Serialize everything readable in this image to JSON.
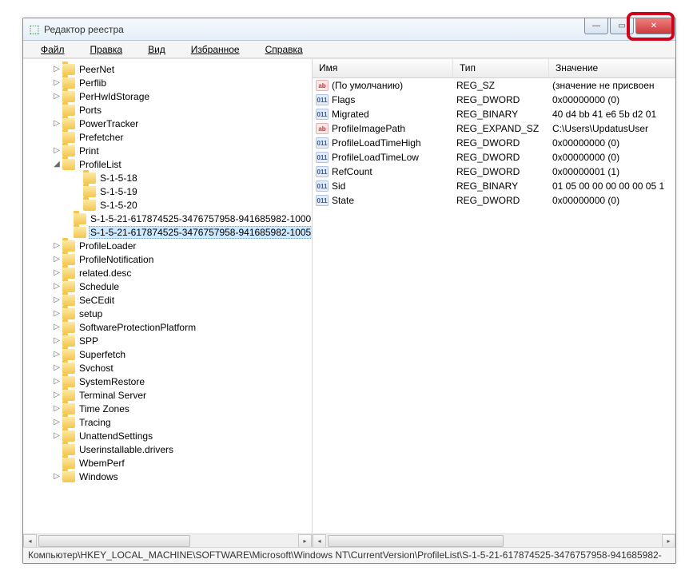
{
  "window": {
    "title": "Редактор реестра"
  },
  "menu": {
    "file": "Файл",
    "edit": "Правка",
    "view": "Вид",
    "favorites": "Избранное",
    "help": "Справка"
  },
  "tree": {
    "items": [
      {
        "label": "PeerNet",
        "depth": 0,
        "twisty": "▷"
      },
      {
        "label": "Perflib",
        "depth": 0,
        "twisty": "▷"
      },
      {
        "label": "PerHwIdStorage",
        "depth": 0,
        "twisty": "▷"
      },
      {
        "label": "Ports",
        "depth": 0,
        "twisty": ""
      },
      {
        "label": "PowerTracker",
        "depth": 0,
        "twisty": "▷"
      },
      {
        "label": "Prefetcher",
        "depth": 0,
        "twisty": ""
      },
      {
        "label": "Print",
        "depth": 0,
        "twisty": "▷"
      },
      {
        "label": "ProfileList",
        "depth": 0,
        "twisty": "◢",
        "expanded": true
      },
      {
        "label": "S-1-5-18",
        "depth": 1,
        "twisty": ""
      },
      {
        "label": "S-1-5-19",
        "depth": 1,
        "twisty": ""
      },
      {
        "label": "S-1-5-20",
        "depth": 1,
        "twisty": ""
      },
      {
        "label": "S-1-5-21-617874525-3476757958-941685982-1000",
        "depth": 1,
        "twisty": ""
      },
      {
        "label": "S-1-5-21-617874525-3476757958-941685982-1005",
        "depth": 1,
        "twisty": "",
        "selected": true
      },
      {
        "label": "ProfileLoader",
        "depth": 0,
        "twisty": "▷"
      },
      {
        "label": "ProfileNotification",
        "depth": 0,
        "twisty": "▷"
      },
      {
        "label": "related.desc",
        "depth": 0,
        "twisty": "▷"
      },
      {
        "label": "Schedule",
        "depth": 0,
        "twisty": "▷"
      },
      {
        "label": "SeCEdit",
        "depth": 0,
        "twisty": "▷"
      },
      {
        "label": "setup",
        "depth": 0,
        "twisty": "▷"
      },
      {
        "label": "SoftwareProtectionPlatform",
        "depth": 0,
        "twisty": "▷"
      },
      {
        "label": "SPP",
        "depth": 0,
        "twisty": "▷"
      },
      {
        "label": "Superfetch",
        "depth": 0,
        "twisty": "▷"
      },
      {
        "label": "Svchost",
        "depth": 0,
        "twisty": "▷"
      },
      {
        "label": "SystemRestore",
        "depth": 0,
        "twisty": "▷"
      },
      {
        "label": "Terminal Server",
        "depth": 0,
        "twisty": "▷"
      },
      {
        "label": "Time Zones",
        "depth": 0,
        "twisty": "▷"
      },
      {
        "label": "Tracing",
        "depth": 0,
        "twisty": "▷"
      },
      {
        "label": "UnattendSettings",
        "depth": 0,
        "twisty": "▷"
      },
      {
        "label": "Userinstallable.drivers",
        "depth": 0,
        "twisty": ""
      },
      {
        "label": "WbemPerf",
        "depth": 0,
        "twisty": ""
      },
      {
        "label": "Windows",
        "depth": 0,
        "twisty": "▷"
      }
    ]
  },
  "list": {
    "headers": {
      "name": "Имя",
      "type": "Тип",
      "data": "Значение"
    },
    "rows": [
      {
        "icon": "sz",
        "name": "(По умолчанию)",
        "type": "REG_SZ",
        "data": "(значение не присвоен"
      },
      {
        "icon": "bin",
        "name": "Flags",
        "type": "REG_DWORD",
        "data": "0x00000000 (0)"
      },
      {
        "icon": "bin",
        "name": "Migrated",
        "type": "REG_BINARY",
        "data": "40 d4 bb 41 e6 5b d2 01"
      },
      {
        "icon": "sz",
        "name": "ProfileImagePath",
        "type": "REG_EXPAND_SZ",
        "data": "C:\\Users\\UpdatusUser"
      },
      {
        "icon": "bin",
        "name": "ProfileLoadTimeHigh",
        "type": "REG_DWORD",
        "data": "0x00000000 (0)"
      },
      {
        "icon": "bin",
        "name": "ProfileLoadTimeLow",
        "type": "REG_DWORD",
        "data": "0x00000000 (0)"
      },
      {
        "icon": "bin",
        "name": "RefCount",
        "type": "REG_DWORD",
        "data": "0x00000001 (1)"
      },
      {
        "icon": "bin",
        "name": "Sid",
        "type": "REG_BINARY",
        "data": "01 05 00 00 00 00 00 05 1"
      },
      {
        "icon": "bin",
        "name": "State",
        "type": "REG_DWORD",
        "data": "0x00000000 (0)"
      }
    ]
  },
  "statusbar": {
    "path": "Компьютер\\HKEY_LOCAL_MACHINE\\SOFTWARE\\Microsoft\\Windows NT\\CurrentVersion\\ProfileList\\S-1-5-21-617874525-3476757958-941685982-"
  }
}
